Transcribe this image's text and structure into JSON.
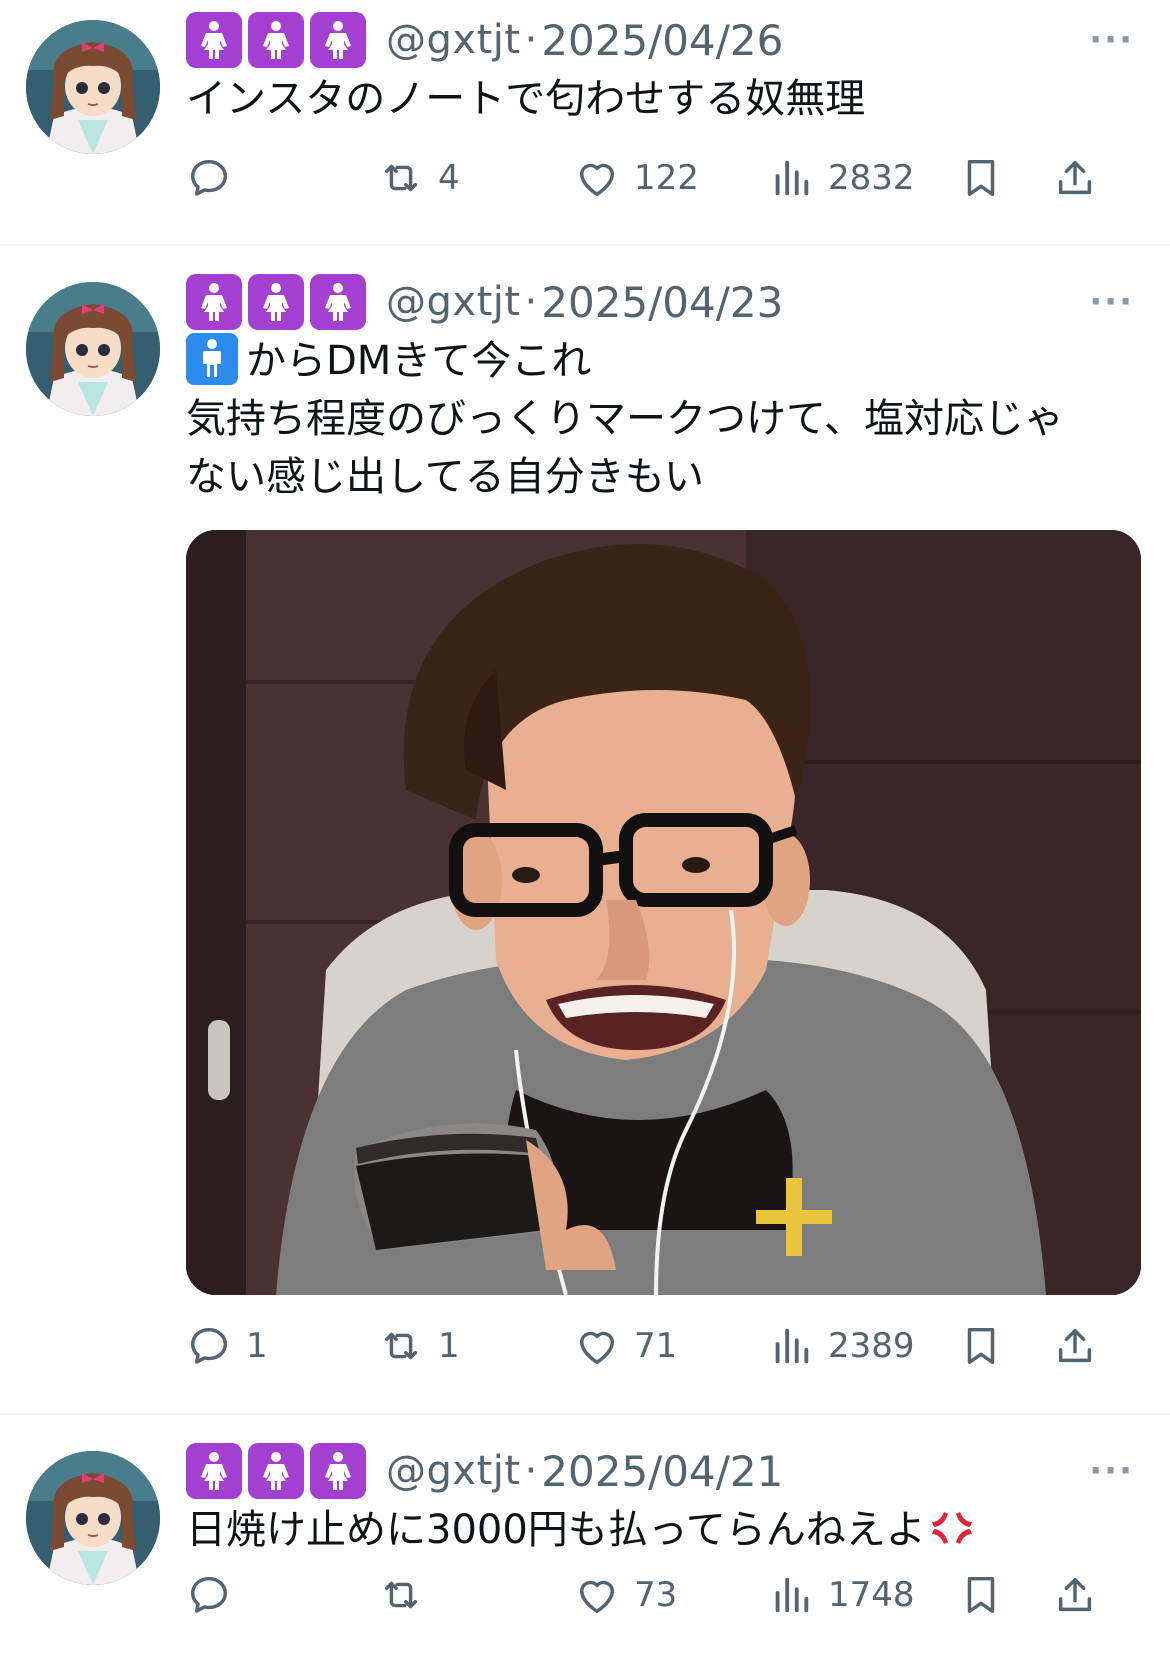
{
  "tweets": [
    {
      "handle": "@gxtjt",
      "dot": "·",
      "date": "2025/04/26",
      "more": "···",
      "lines": [
        "インスタのノートで匂わせする奴無理"
      ],
      "replies": "",
      "retweets": "4",
      "likes": "122",
      "views": "2832"
    },
    {
      "handle": "@gxtjt",
      "dot": "·",
      "date": "2025/04/23",
      "more": "···",
      "lead_emoji": "man-symbol-emoji",
      "lines": [
        "からDMきて今これ",
        "気持ち程度のびっくりマークつけて、塩対応じゃ",
        "ない感じ出してる自分きもい"
      ],
      "replies": "1",
      "retweets": "1",
      "likes": "71",
      "views": "2389"
    },
    {
      "handle": "@gxtjt",
      "dot": "·",
      "date": "2025/04/21",
      "more": "···",
      "trail_emoji": "anger-symbol-emoji",
      "lines": [
        "日焼け止めに3000円も払ってらんねえよ"
      ],
      "replies": "",
      "retweets": "",
      "likes": "73",
      "views": "1748"
    }
  ],
  "icons": {
    "badge": "woman-symbol-emoji",
    "reply": "reply-icon",
    "retweet": "retweet-icon",
    "like": "heart-icon",
    "views": "views-icon",
    "bookmark": "bookmark-icon",
    "share": "share-icon"
  },
  "colors": {
    "badge": "#a33fd1",
    "man_badge": "#2d8ceb",
    "secondary_text": "#536471",
    "anger": "#e0243c"
  }
}
